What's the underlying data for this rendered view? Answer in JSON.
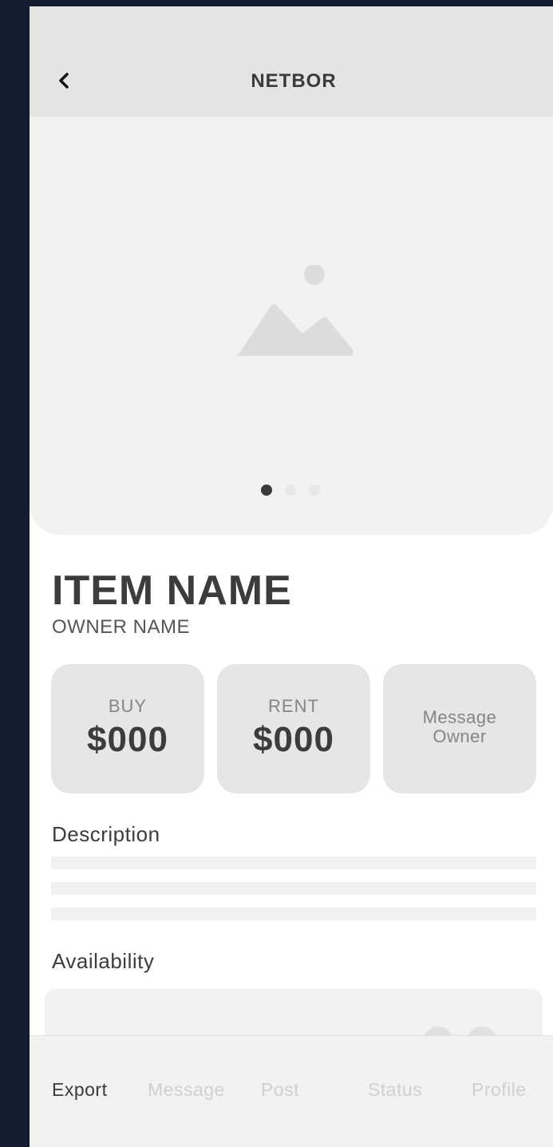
{
  "header": {
    "title": "NETBOR"
  },
  "carousel": {
    "slides": 3,
    "active_index": 0
  },
  "item": {
    "name": "ITEM NAME",
    "owner": "OWNER NAME"
  },
  "actions": {
    "buy": {
      "label": "BUY",
      "price": "$000"
    },
    "rent": {
      "label": "RENT",
      "price": "$000"
    },
    "message": {
      "label": "Message\nOwner"
    }
  },
  "sections": {
    "description": "Description",
    "availability": "Availability"
  },
  "nav": {
    "items": [
      "Export",
      "Message",
      "Post",
      "Status",
      "Profile"
    ],
    "active_index": 0
  },
  "colors": {
    "background": "#141d2d",
    "topbar": "#e4e4e4",
    "card": "#e6e6e6",
    "text_dark": "#3c3c3c",
    "nav_inactive": "#d0d0d0"
  }
}
